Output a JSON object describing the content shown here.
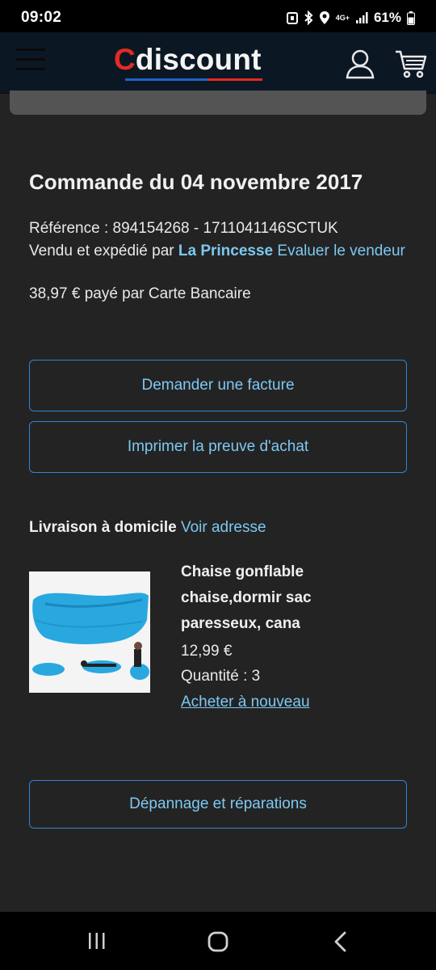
{
  "status_bar": {
    "time": "09:02",
    "network": "4G+",
    "battery": "61%"
  },
  "header": {
    "logo_first_letter": "C",
    "logo_rest": "discount",
    "icons": [
      "menu-icon",
      "user-icon",
      "cart-icon"
    ]
  },
  "order": {
    "title": "Commande du 04 novembre 2017",
    "reference": "Référence : 894154268 - 1711041146SCTUK",
    "sold_by_prefix": "Vendu et expédié par",
    "seller_name": "La Princesse",
    "rate_seller_link": "Evaluer le vendeur",
    "paid_amount": "38,97 €",
    "paid_by": "payé par Carte Bancaire"
  },
  "actions": {
    "invoice_button": "Demander une facture",
    "proof_button": "Imprimer la preuve d'achat",
    "repair_button": "Dépannage et réparations"
  },
  "delivery": {
    "label": "Livraison à domicile",
    "view_address_link": "Voir adresse"
  },
  "product": {
    "name": "Chaise gonflable chaise,dormir sac paresseux, cana",
    "price": "12,99 €",
    "quantity": "Quantité : 3",
    "rebuy_link": "Acheter à nouveau"
  },
  "colors": {
    "background": "#232323",
    "header": "#0c1724",
    "link": "#7ec8f2",
    "button_border": "#2f86d9",
    "brand_red": "#e32b22"
  }
}
